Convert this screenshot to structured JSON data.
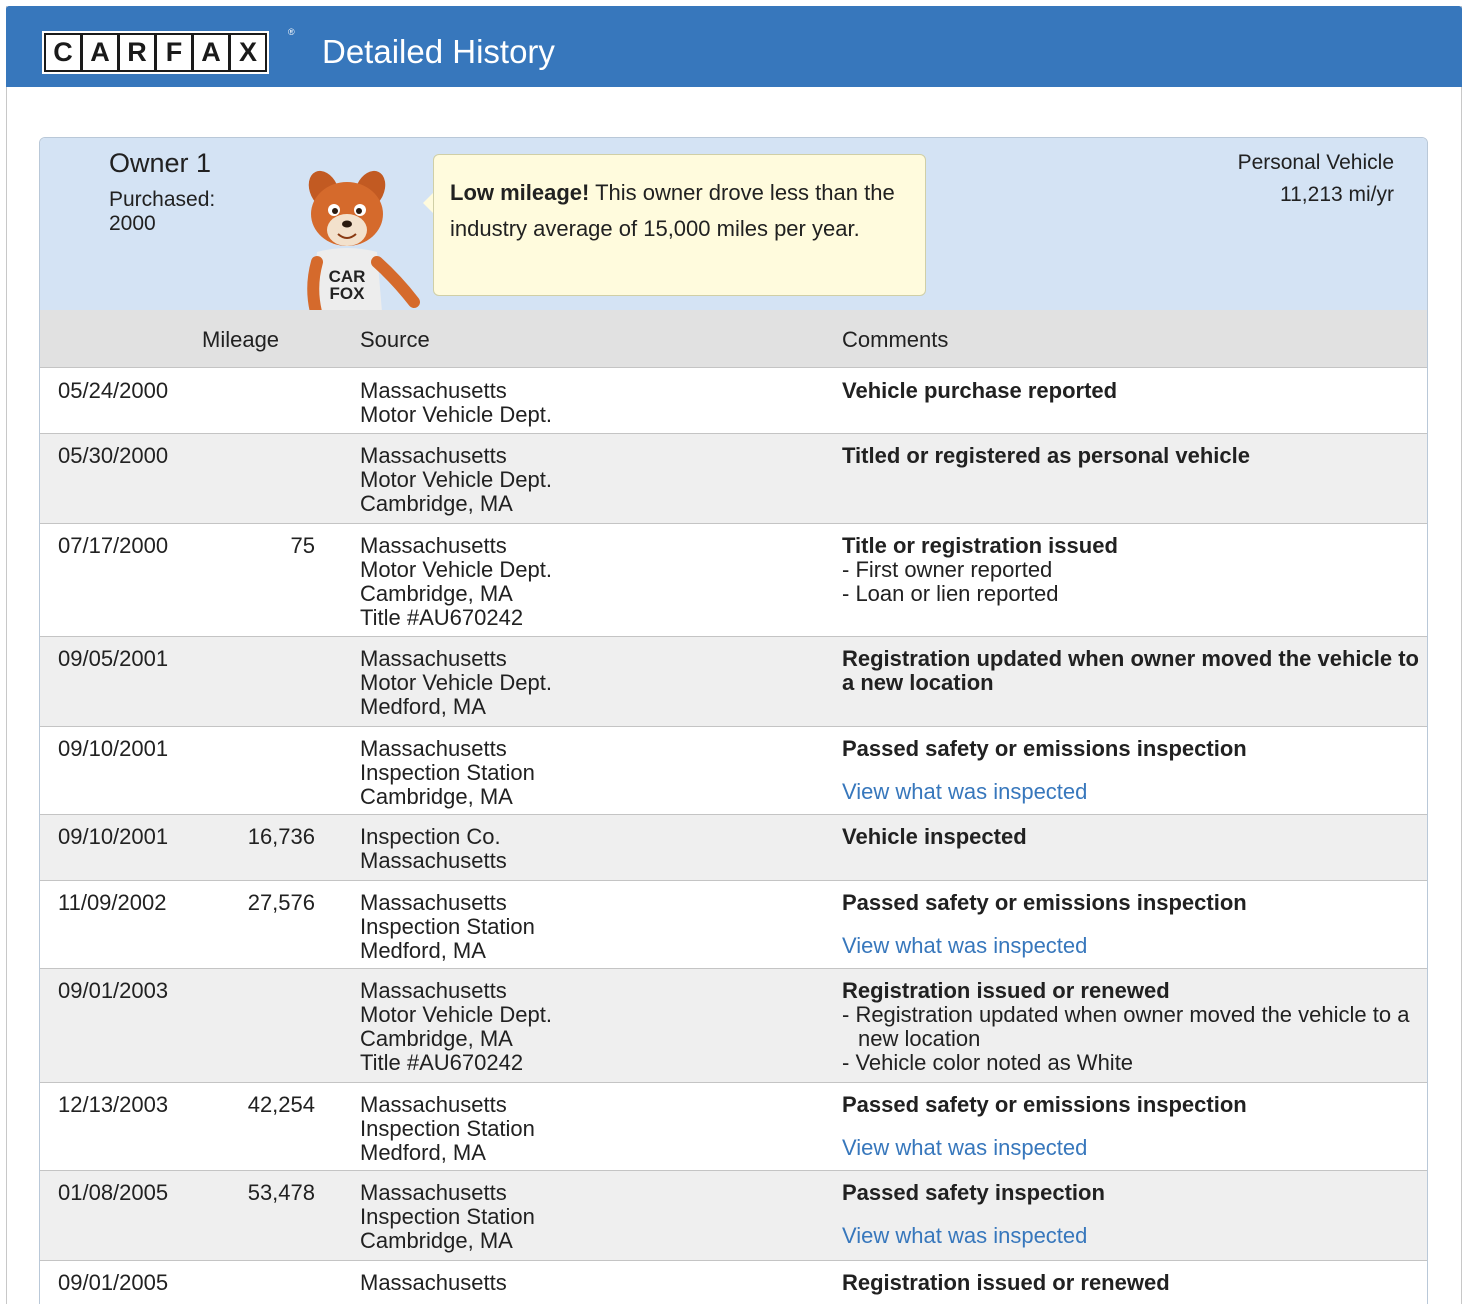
{
  "header": {
    "logo_letters": [
      "C",
      "A",
      "R",
      "F",
      "A",
      "X"
    ],
    "logo_reg": "®",
    "title": "Detailed History"
  },
  "owner": {
    "name": "Owner 1",
    "purchased_label": "Purchased:",
    "purchased_year": "2000",
    "bubble_bold": "Low mileage!",
    "bubble_text": " This owner drove less than the industry average of 15,000 miles per year.",
    "vehicle_type": "Personal Vehicle",
    "miles_per_year": "11,213 mi/yr",
    "mascot_shirt_line1": "CAR",
    "mascot_shirt_line2": "FOX"
  },
  "table": {
    "headers": {
      "mileage": "Mileage",
      "source": "Source",
      "comments": "Comments"
    },
    "rows": [
      {
        "date": "05/24/2000",
        "mileage": "",
        "source": [
          "Massachusetts",
          "Motor Vehicle Dept."
        ],
        "comment": "Vehicle purchase reported",
        "bullets": [],
        "link": ""
      },
      {
        "date": "05/30/2000",
        "mileage": "",
        "source": [
          "Massachusetts",
          "Motor Vehicle Dept.",
          "Cambridge, MA"
        ],
        "comment": "Titled or registered as personal vehicle",
        "bullets": [],
        "link": ""
      },
      {
        "date": "07/17/2000",
        "mileage": "75",
        "source": [
          "Massachusetts",
          "Motor Vehicle Dept.",
          "Cambridge, MA",
          "Title #AU670242"
        ],
        "comment": "Title or registration issued",
        "bullets": [
          "- First owner reported",
          "- Loan or lien reported"
        ],
        "link": ""
      },
      {
        "date": "09/05/2001",
        "mileage": "",
        "source": [
          "Massachusetts",
          "Motor Vehicle Dept.",
          "Medford, MA"
        ],
        "comment": "Registration updated when owner moved the vehicle to a new location",
        "bullets": [],
        "link": ""
      },
      {
        "date": "09/10/2001",
        "mileage": "",
        "source": [
          "Massachusetts",
          "Inspection Station",
          "Cambridge, MA"
        ],
        "comment": "Passed safety or emissions inspection",
        "bullets": [],
        "link": "View what was inspected"
      },
      {
        "date": "09/10/2001",
        "mileage": "16,736",
        "source": [
          "Inspection Co.",
          "Massachusetts"
        ],
        "comment": "Vehicle inspected",
        "bullets": [],
        "link": ""
      },
      {
        "date": "11/09/2002",
        "mileage": "27,576",
        "source": [
          "Massachusetts",
          "Inspection Station",
          "Medford, MA"
        ],
        "comment": "Passed safety or emissions inspection",
        "bullets": [],
        "link": "View what was inspected"
      },
      {
        "date": "09/01/2003",
        "mileage": "",
        "source": [
          "Massachusetts",
          "Motor Vehicle Dept.",
          "Cambridge, MA",
          "Title #AU670242"
        ],
        "comment": "Registration issued or renewed",
        "bullets": [
          "- Registration updated when owner moved the vehicle to a new location",
          "- Vehicle color noted as White"
        ],
        "link": ""
      },
      {
        "date": "12/13/2003",
        "mileage": "42,254",
        "source": [
          "Massachusetts",
          "Inspection Station",
          "Medford, MA"
        ],
        "comment": "Passed safety or emissions inspection",
        "bullets": [],
        "link": "View what was inspected"
      },
      {
        "date": "01/08/2005",
        "mileage": "53,478",
        "source": [
          "Massachusetts",
          "Inspection Station",
          "Cambridge, MA"
        ],
        "comment": "Passed safety inspection",
        "bullets": [],
        "link": "View what was inspected"
      },
      {
        "date": "09/01/2005",
        "mileage": "",
        "source": [
          "Massachusetts"
        ],
        "comment": "Registration issued or renewed",
        "bullets": [],
        "link": ""
      }
    ]
  },
  "colors": {
    "header_blue": "#3777bc",
    "owner_band": "#d4e3f4",
    "bubble_bg": "#fffbdd",
    "link": "#3777bc"
  }
}
